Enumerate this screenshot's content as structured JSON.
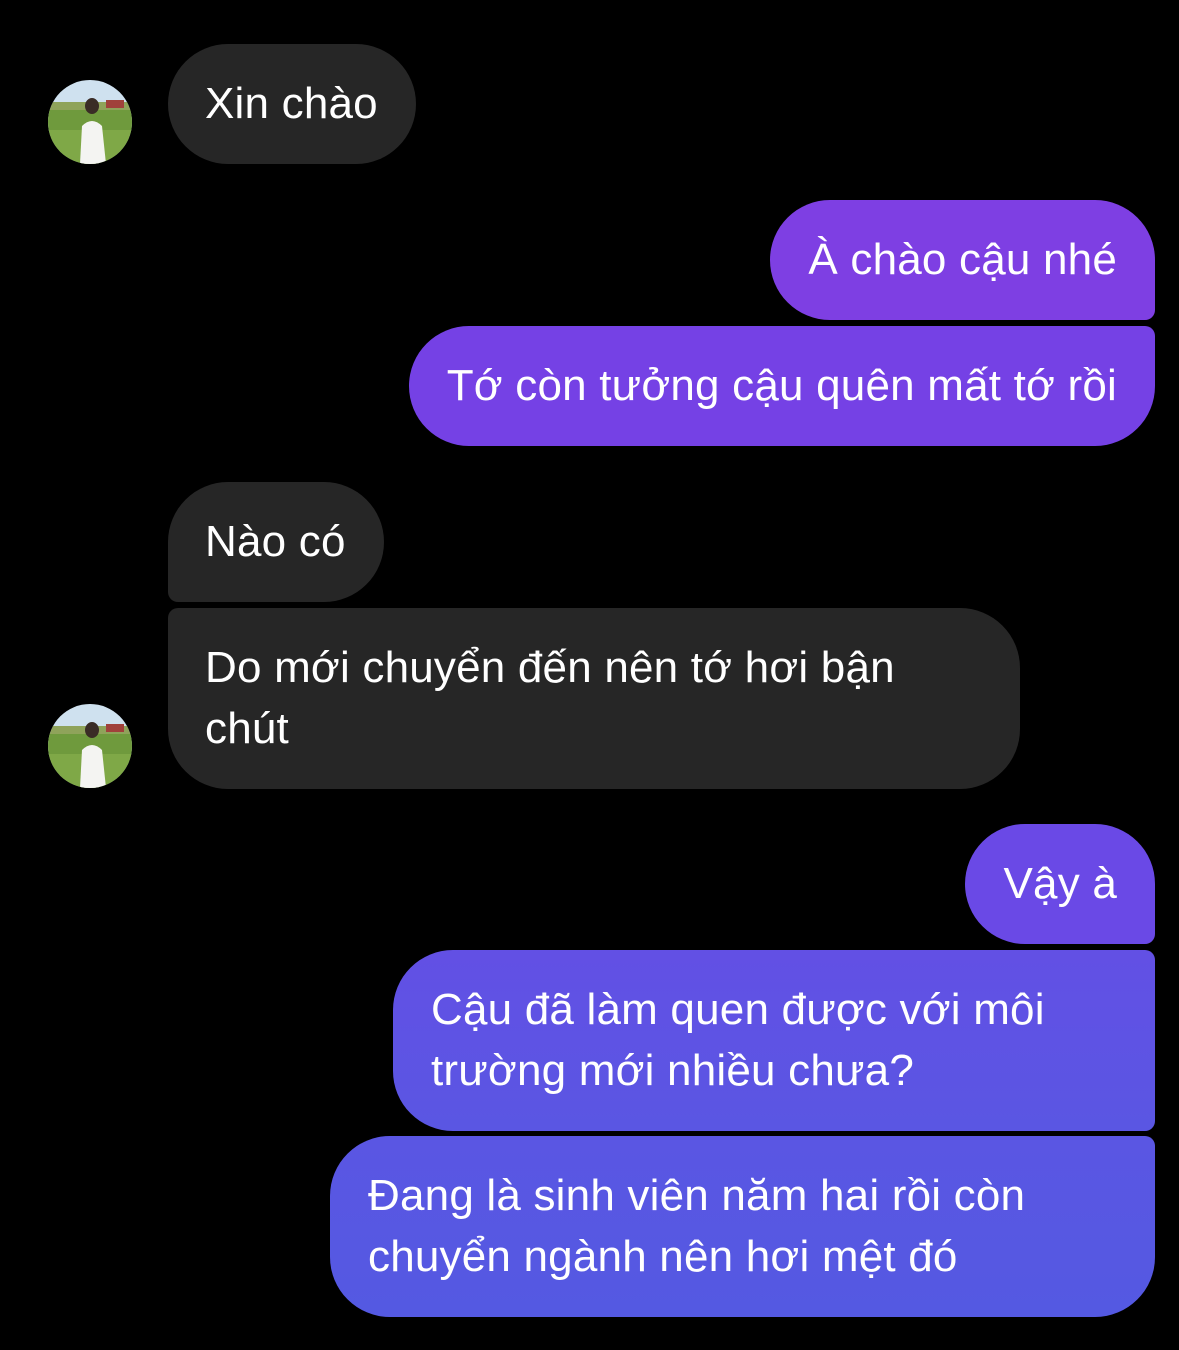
{
  "messages": [
    {
      "sender": "contact",
      "text": "Xin chào"
    },
    {
      "sender": "me",
      "text": "À chào cậu nhé"
    },
    {
      "sender": "me",
      "text": "Tớ còn tưởng cậu quên mất tớ rồi"
    },
    {
      "sender": "contact",
      "text": "Nào có"
    },
    {
      "sender": "contact",
      "text": "Do mới chuyển đến nên tớ hơi bận chút"
    },
    {
      "sender": "me",
      "text": "Vậy à"
    },
    {
      "sender": "me",
      "text": "Cậu đã làm quen được với môi trường mới nhiều chưa?"
    },
    {
      "sender": "me",
      "text": "Đang là sinh viên năm hai rồi còn chuyển ngành nên hơi mệt đó"
    }
  ],
  "colors": {
    "background": "#000000",
    "incoming_bubble": "#262626",
    "outgoing_bubble_top": "#7e3fe3",
    "outgoing_bubble_bottom": "#5459e2",
    "text": "#ffffff"
  },
  "avatar": {
    "icon": "contact-avatar-icon"
  }
}
